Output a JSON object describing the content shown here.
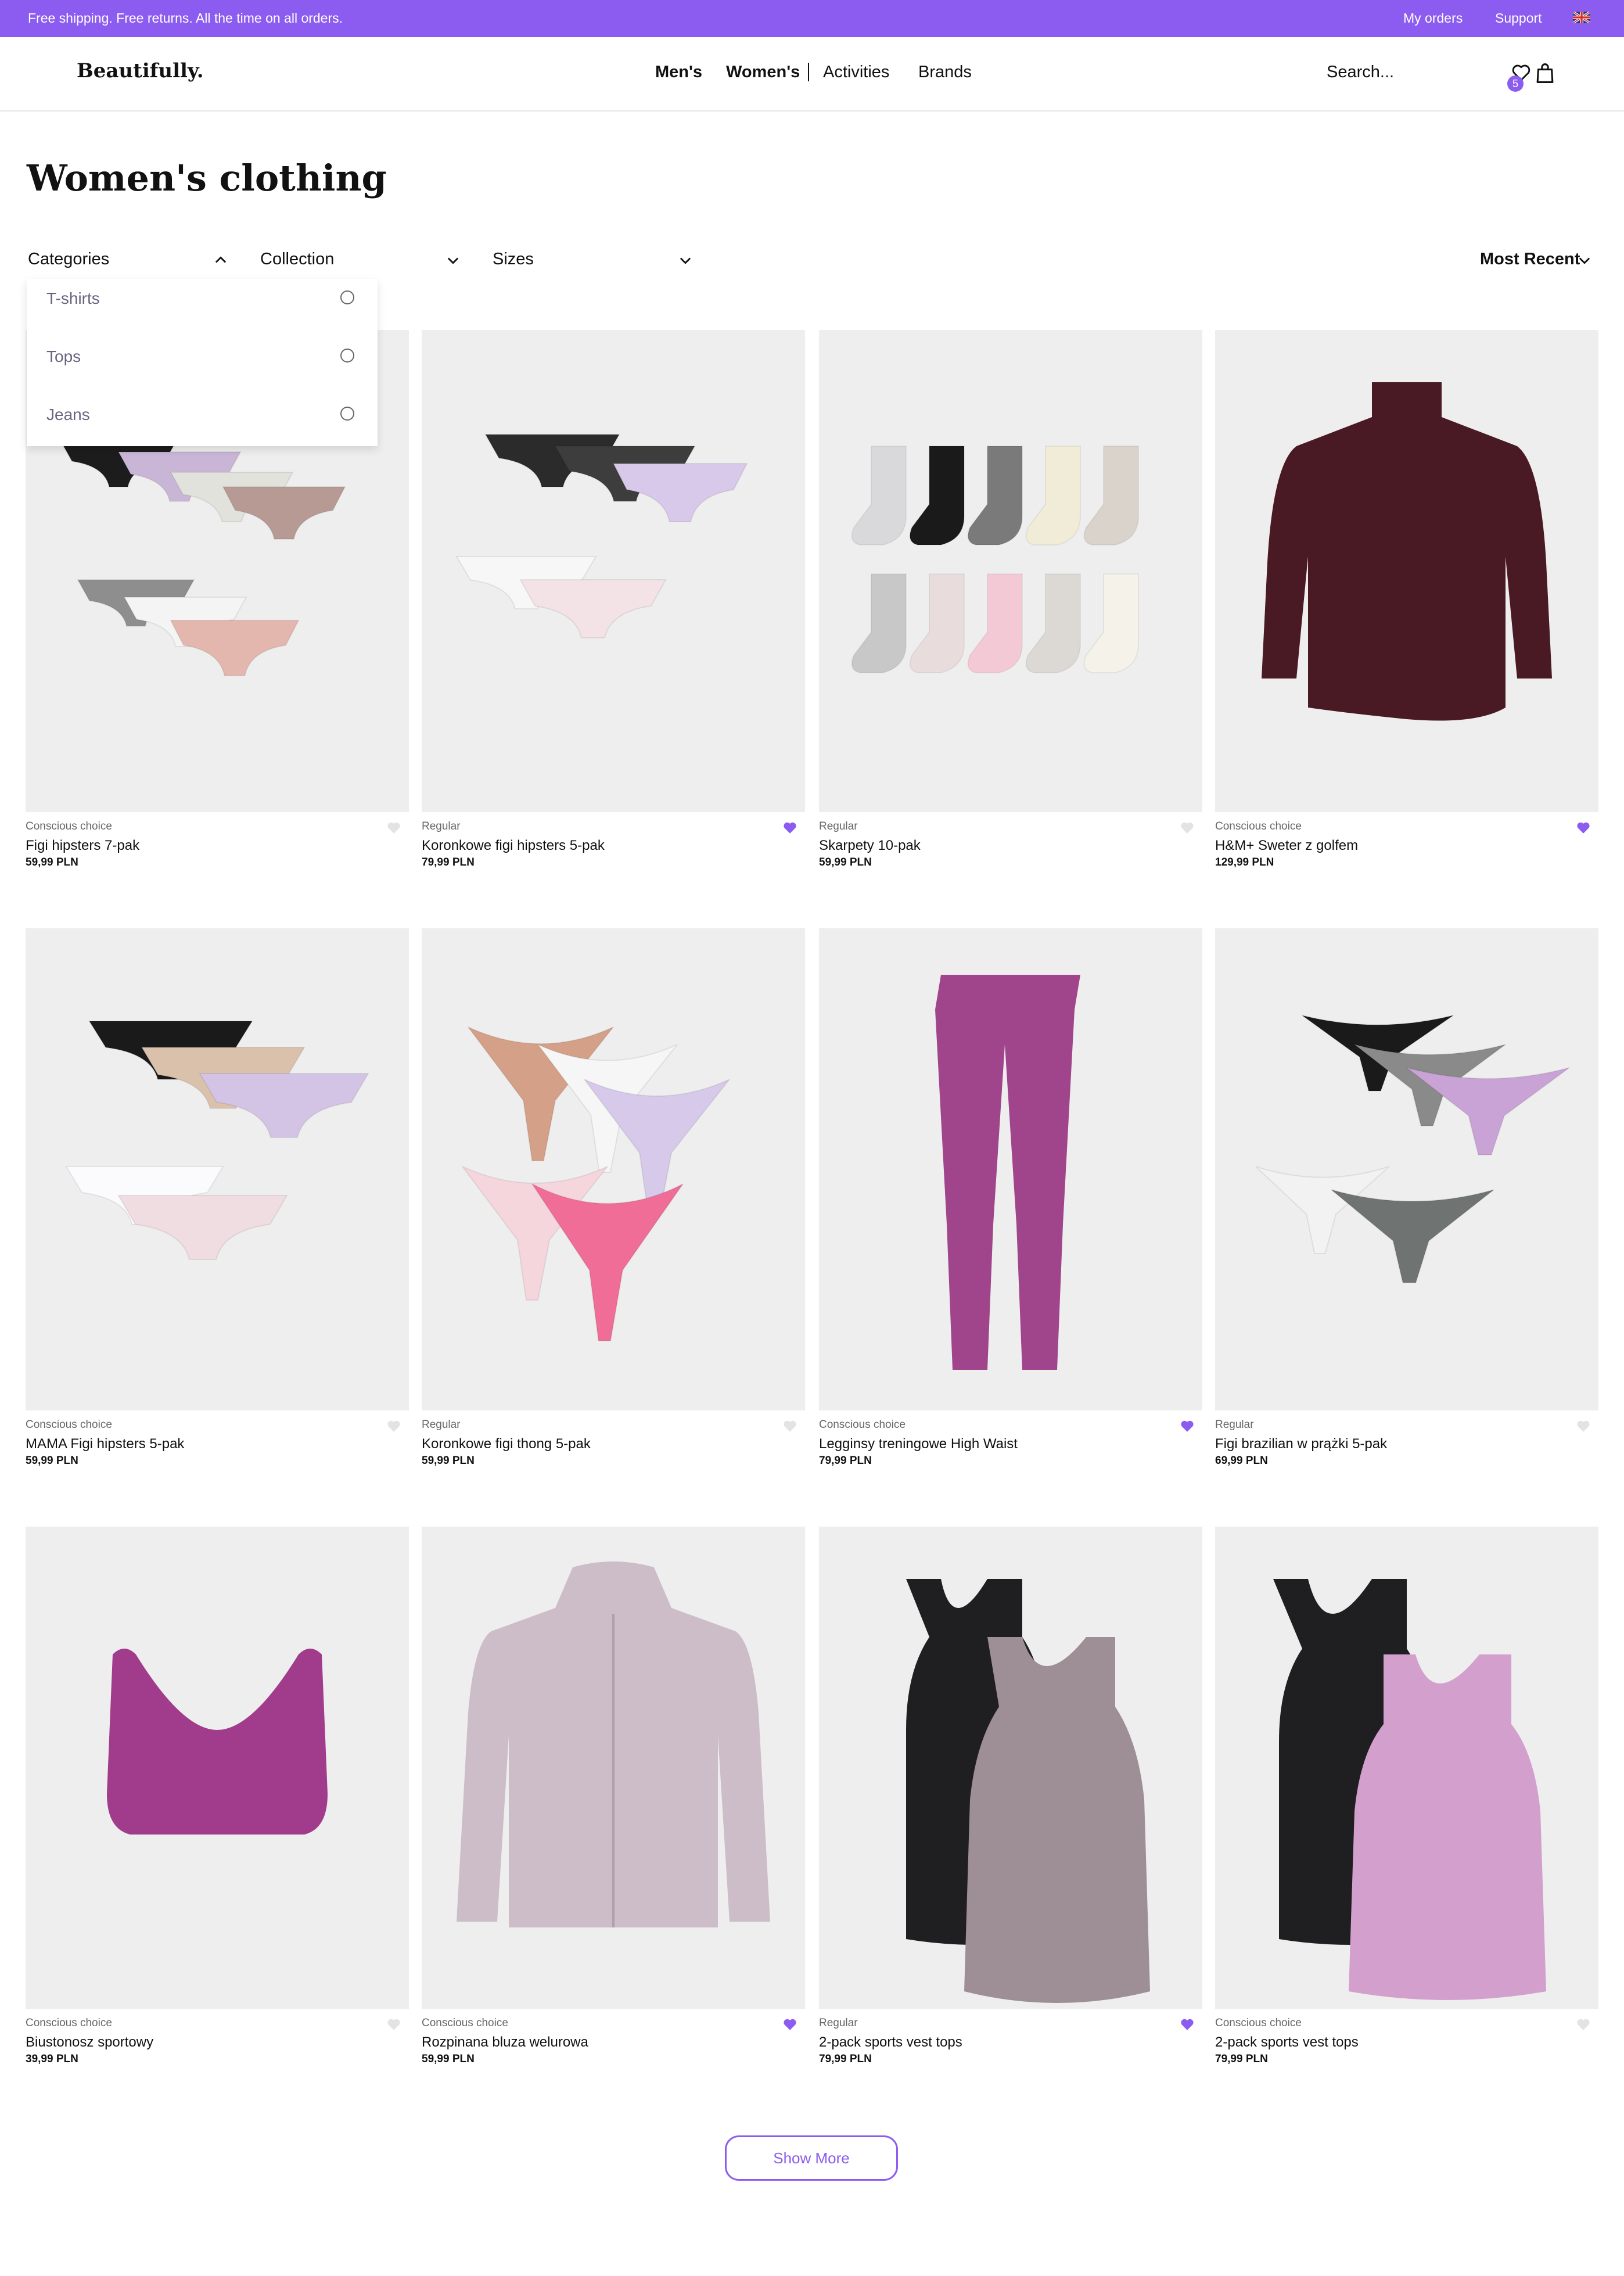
{
  "topbar": {
    "promo": "Free shipping. Free returns. All the time on all orders.",
    "my_orders": "My orders",
    "support": "Support",
    "language_icon": "uk-flag-icon"
  },
  "header": {
    "logo": "Beautifully.",
    "nav": [
      "Men's",
      "Women's",
      "Activities",
      "Brands"
    ],
    "search_placeholder": "Search...",
    "wishlist_count": "5",
    "icons": [
      "heart-icon",
      "shopping-bag-icon"
    ]
  },
  "page": {
    "title": "Women's clothing"
  },
  "filters": {
    "categories": "Categories",
    "collection": "Collection",
    "sizes": "Sizes",
    "sort": "Most Recent",
    "categories_open": true,
    "category_options": [
      "T-shirts",
      "Tops",
      "Jeans"
    ]
  },
  "colors": {
    "accent": "#8c5cf0",
    "fav_active": "#8c5cf0",
    "fav_inactive": "#e3e3e3",
    "photo_bg": "#eeeeee"
  },
  "products": [
    {
      "category": "Conscious choice",
      "name": "Figi hipsters 7-pak",
      "price": "59,99 PLN",
      "favorite": false,
      "image_icon": "briefs-pack-icon"
    },
    {
      "category": "Regular",
      "name": "Koronkowe figi hipsters 5-pak",
      "price": "79,99 PLN",
      "favorite": true,
      "image_icon": "lace-briefs-icon"
    },
    {
      "category": "Regular",
      "name": "Skarpety 10-pak",
      "price": "59,99 PLN",
      "favorite": false,
      "image_icon": "socks-icon"
    },
    {
      "category": "Conscious choice",
      "name": "H&M+ Sweter z golfem",
      "price": "129,99 PLN",
      "favorite": true,
      "image_icon": "turtleneck-sweater-icon"
    },
    {
      "category": "Conscious choice",
      "name": "MAMA Figi hipsters 5-pak",
      "price": "59,99 PLN",
      "favorite": false,
      "image_icon": "briefs-pack-icon"
    },
    {
      "category": "Regular",
      "name": "Koronkowe figi thong 5-pak",
      "price": "59,99 PLN",
      "favorite": false,
      "image_icon": "lace-thong-icon"
    },
    {
      "category": "Conscious choice",
      "name": "Legginsy treningowe High Waist",
      "price": "79,99 PLN",
      "favorite": true,
      "image_icon": "leggings-icon"
    },
    {
      "category": "Regular",
      "name": "Figi brazilian w prążki 5-pak",
      "price": "69,99 PLN",
      "favorite": false,
      "image_icon": "thong-pack-icon"
    },
    {
      "category": "Conscious choice",
      "name": "Biustonosz sportowy",
      "price": "39,99 PLN",
      "favorite": false,
      "image_icon": "sports-bra-icon"
    },
    {
      "category": "Conscious choice",
      "name": "Rozpinana bluza welurowa",
      "price": "59,99 PLN",
      "favorite": true,
      "image_icon": "hoodie-icon"
    },
    {
      "category": "Regular",
      "name": "2-pack sports vest tops",
      "price": "79,99 PLN",
      "favorite": true,
      "image_icon": "vest-tops-icon"
    },
    {
      "category": "Conscious choice",
      "name": "2-pack sports vest tops",
      "price": "79,99 PLN",
      "favorite": false,
      "image_icon": "vest-tops-icon"
    }
  ],
  "show_more": "Show More"
}
